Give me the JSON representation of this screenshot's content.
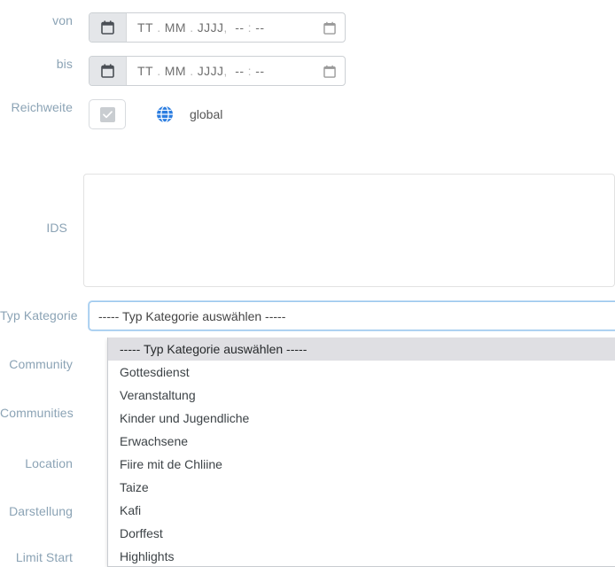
{
  "form": {
    "rows": [
      {
        "label": "von",
        "type": "datetime"
      },
      {
        "label": "bis",
        "type": "datetime"
      },
      {
        "label": "Reichweite",
        "type": "checkbox"
      },
      {
        "label": "IDS",
        "type": "textarea"
      },
      {
        "label": "Typ Kategorie",
        "type": "select"
      },
      {
        "label": "Community",
        "type": "spacer"
      },
      {
        "label": "Communities",
        "type": "spacer"
      },
      {
        "label": "Location",
        "type": "spacer"
      },
      {
        "label": "Darstellung",
        "type": "spacer"
      },
      {
        "label": "Limit Start",
        "type": "spacer"
      }
    ]
  },
  "date_from": {
    "label": "von",
    "placeholder": "TT . MM . JJJJ ,  -- : --",
    "value": "",
    "day": "TT",
    "month": "MM",
    "year": "JJJJ",
    "hour": "--",
    "minute": "--",
    "picker_button_icon": "calendar-icon",
    "native_icon": "calendar-icon"
  },
  "date_to": {
    "label": "bis",
    "placeholder": "TT . MM . JJJJ ,  -- : --",
    "value": "",
    "day": "TT",
    "month": "MM",
    "year": "JJJJ",
    "hour": "--",
    "minute": "--",
    "picker_button_icon": "calendar-icon",
    "native_icon": "calendar-icon"
  },
  "reichweite": {
    "label": "Reichweite",
    "checked": true,
    "disabled": true,
    "icon": "globe-icon",
    "icon_color": "#2b7de0",
    "scope_label": "global"
  },
  "ids": {
    "label": "IDS",
    "value": "",
    "placeholder": ""
  },
  "typ_kategorie": {
    "label": "Typ Kategorie",
    "selected": "----- Typ Kategorie auswählen -----",
    "expanded": true,
    "highlighted_index": 0,
    "options": [
      "----- Typ Kategorie auswählen -----",
      "Gottesdienst",
      "Veranstaltung",
      "Kinder und Jugendliche",
      "Erwachsene",
      "Fiire mit de Chliine",
      "Taize",
      "Kafi",
      "Dorffest",
      "Highlights"
    ]
  },
  "labels": {
    "community": "Community",
    "communities": "Communities",
    "location": "Location",
    "darstellung": "Darstellung",
    "limit_start": "Limit Start"
  },
  "colors": {
    "label_text": "#8ba3b5",
    "focus_border": "#9dc8ee",
    "highlight_bg": "#dfdfe3",
    "globe_blue": "#2b7de0"
  }
}
